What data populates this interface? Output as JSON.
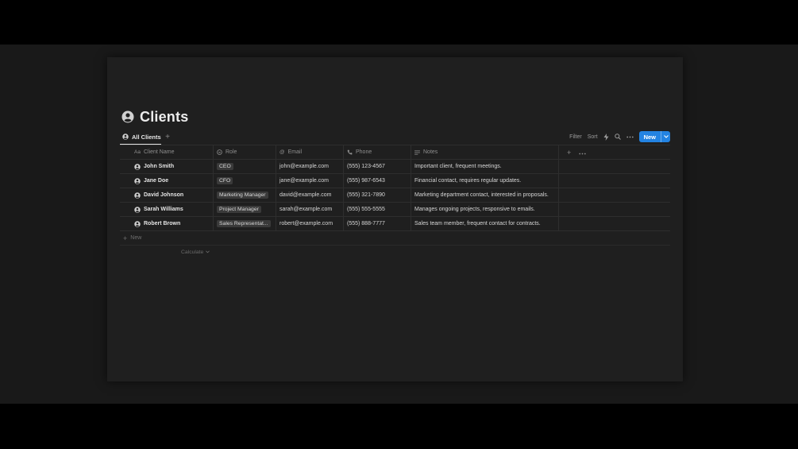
{
  "page": {
    "title": "Clients"
  },
  "views": {
    "tabs": [
      {
        "label": "All Clients"
      }
    ],
    "add_view": "+"
  },
  "toolbar": {
    "filter_label": "Filter",
    "sort_label": "Sort",
    "new_label": "New",
    "accent_color": "#2383e2"
  },
  "table": {
    "columns": [
      {
        "label": "Client Name",
        "icon": "text-icon"
      },
      {
        "label": "Role",
        "icon": "select-icon"
      },
      {
        "label": "Email",
        "icon": "at-icon"
      },
      {
        "label": "Phone",
        "icon": "phone-icon"
      },
      {
        "label": "Notes",
        "icon": "lines-icon"
      }
    ],
    "rows": [
      {
        "name": "John Smith",
        "role": "CEO",
        "email": "john@example.com",
        "phone": "(555) 123-4567",
        "notes": "Important client, frequent meetings."
      },
      {
        "name": "Jane Doe",
        "role": "CFO",
        "email": "jane@example.com",
        "phone": "(555) 987-6543",
        "notes": "Financial contact, requires regular updates."
      },
      {
        "name": "David Johnson",
        "role": "Marketing Manager",
        "email": "david@example.com",
        "phone": "(555) 321-7890",
        "notes": "Marketing department contact, interested in proposals."
      },
      {
        "name": "Sarah Williams",
        "role": "Project Manager",
        "email": "sarah@example.com",
        "phone": "(555) 555-5555",
        "notes": "Manages ongoing projects, responsive to emails."
      },
      {
        "name": "Robert Brown",
        "role": "Sales Representat...",
        "email": "robert@example.com",
        "phone": "(555) 888-7777",
        "notes": "Sales team member, frequent contact for contracts."
      }
    ],
    "new_row_label": "New",
    "calculate_label": "Calculate"
  }
}
